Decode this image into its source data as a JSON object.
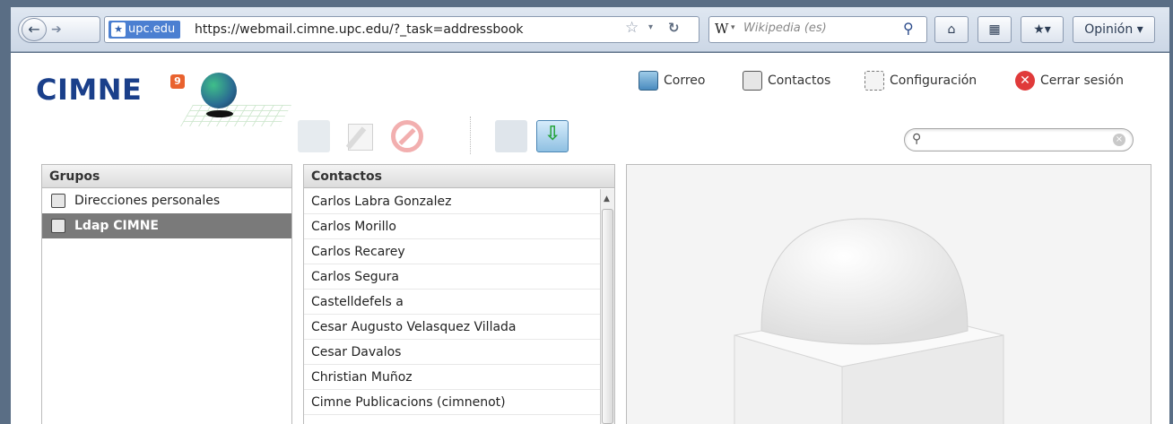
{
  "browser": {
    "site_identity": "upc.edu",
    "url": "https://webmail.cimne.upc.edu/?_task=addressbook",
    "search_engine_placeholder": "Wikipedia (es)",
    "feedback_label": "Opinión ▾"
  },
  "app": {
    "logo_text": "CIMNE",
    "logo_badge": "9",
    "nav": {
      "mail": "Correo",
      "contacts": "Contactos",
      "settings": "Configuración",
      "logout": "Cerrar sesión"
    },
    "groups": {
      "header": "Grupos",
      "items": [
        {
          "label": "Direcciones personales",
          "selected": false
        },
        {
          "label": "Ldap CIMNE",
          "selected": true
        }
      ]
    },
    "contacts": {
      "header": "Contactos",
      "items": [
        "Carlos Labra Gonzalez",
        "Carlos Morillo",
        "Carlos Recarey",
        "Carlos Segura",
        "Castelldefels a",
        "Cesar Augusto Velasquez Villada",
        "Cesar Davalos",
        "Christian Muñoz",
        "Cimne Publicacions (cimnenot)"
      ]
    },
    "search": {
      "placeholder": "",
      "value": ""
    }
  },
  "colors": {
    "selected_row": "#7a7a7a",
    "logo_blue": "#1a3f8a",
    "logout_red": "#e03a3a"
  }
}
